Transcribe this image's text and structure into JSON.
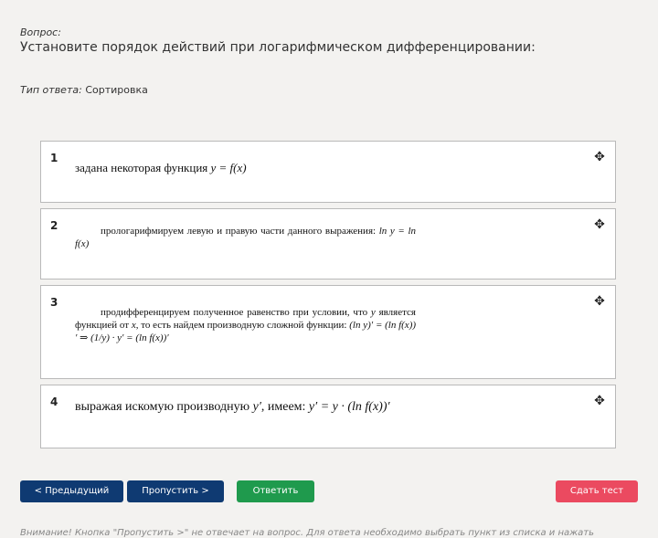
{
  "question": {
    "label": "Вопрос:",
    "text": "Установите порядок действий при логарифмическом дифференцировании:"
  },
  "answer_type": {
    "label": "Тип ответа:",
    "value": "Сортировка"
  },
  "items": [
    {
      "number": "1",
      "text": "задана некоторая функция",
      "math": "y = f(x)"
    },
    {
      "number": "2",
      "text": "прологарифмируем левую и правую части данного выражения:",
      "math": "ln y = ln f(x)"
    },
    {
      "number": "3",
      "text_a": "продифференцируем полученное равенство при условии, что",
      "math_a": "y",
      "text_b": "является функцией от",
      "math_b": "x",
      "text_c": ", то есть найдем производную сложной функции:",
      "math_c": "(ln y)′ = (ln f(x))′ ⇒ (1/y) · y′ = (ln f(x))′"
    },
    {
      "number": "4",
      "text_a": "выражая искомую производную",
      "math_a": "y′",
      "text_b": ", имеем:",
      "math_b": "y′ = y · (ln f(x))′"
    }
  ],
  "buttons": {
    "prev": "< Предыдущий",
    "skip": "Пропустить >",
    "answer": "Ответить",
    "finish": "Сдать тест"
  },
  "footer_note": "Внимание! Кнопка \"Пропустить >\" не отвечает на вопрос. Для ответа необходимо выбрать пункт из списка и нажать"
}
